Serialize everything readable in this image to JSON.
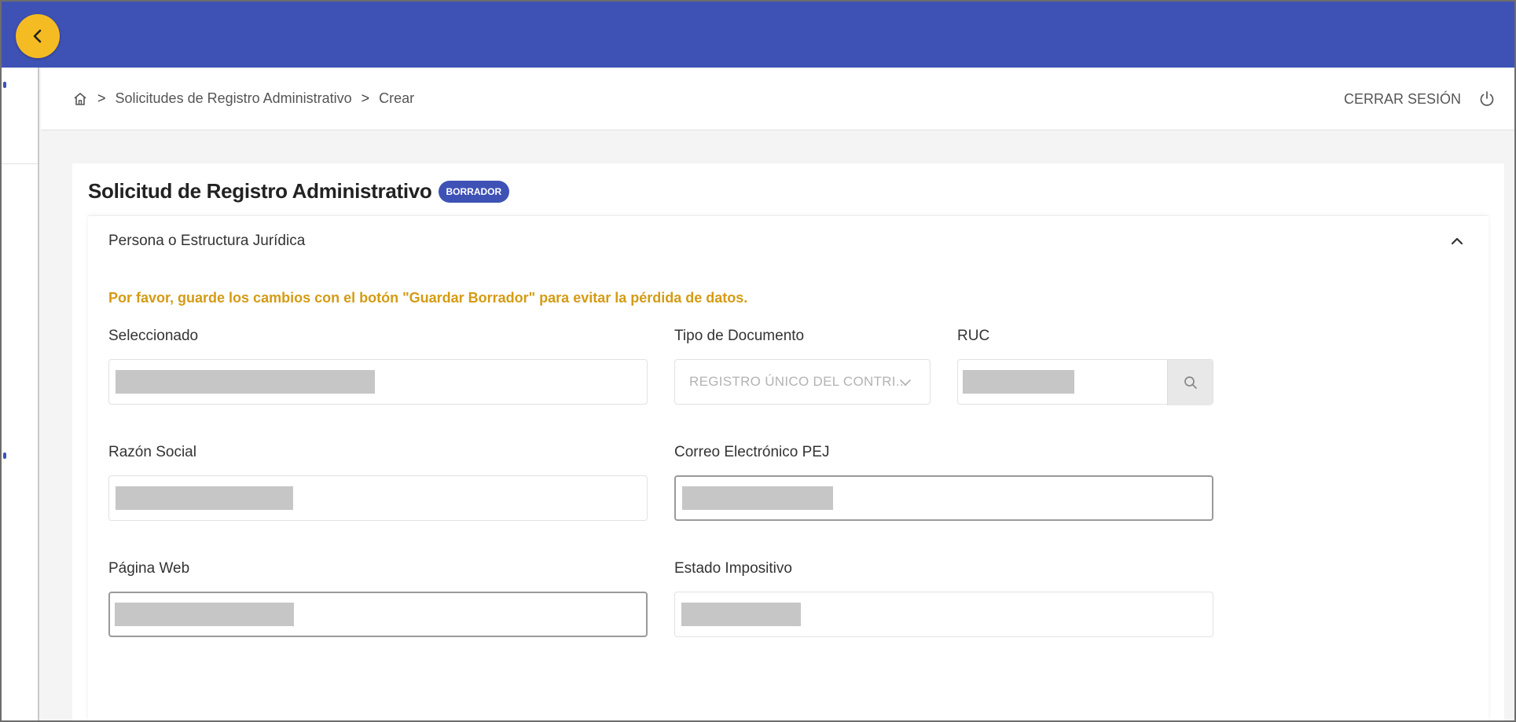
{
  "topbar": {
    "back_icon": "chevron-left-icon",
    "accent": "#3e52b5",
    "back_color": "#f5bb22"
  },
  "breadcrumb": {
    "home_icon": "home-icon",
    "items": [
      "Solicitudes de Registro Administrativo",
      "Crear"
    ],
    "separator": ">"
  },
  "header": {
    "logout_label": "CERRAR SESIÓN",
    "logout_icon": "power-icon"
  },
  "form": {
    "title": "Solicitud de Registro Administrativo",
    "status_badge": "BORRADOR",
    "section_title": "Persona o Estructura Jurídica",
    "warning": "Por favor, guarde los cambios con el botón \"Guardar Borrador\" para evitar la pérdida de datos.",
    "fields": {
      "seleccionado": {
        "label": "Seleccionado"
      },
      "tipo_documento": {
        "label": "Tipo de Documento",
        "value": "REGISTRO ÚNICO DEL CONTRI..."
      },
      "ruc": {
        "label": "RUC",
        "search_icon": "search-icon"
      },
      "razon_social": {
        "label": "Razón Social"
      },
      "correo": {
        "label": "Correo Electrónico PEJ"
      },
      "pagina_web": {
        "label": "Página Web"
      },
      "estado_impositivo": {
        "label": "Estado Impositivo"
      }
    }
  },
  "colors": {
    "warning": "#d49b14",
    "badge": "#3e52b5"
  }
}
